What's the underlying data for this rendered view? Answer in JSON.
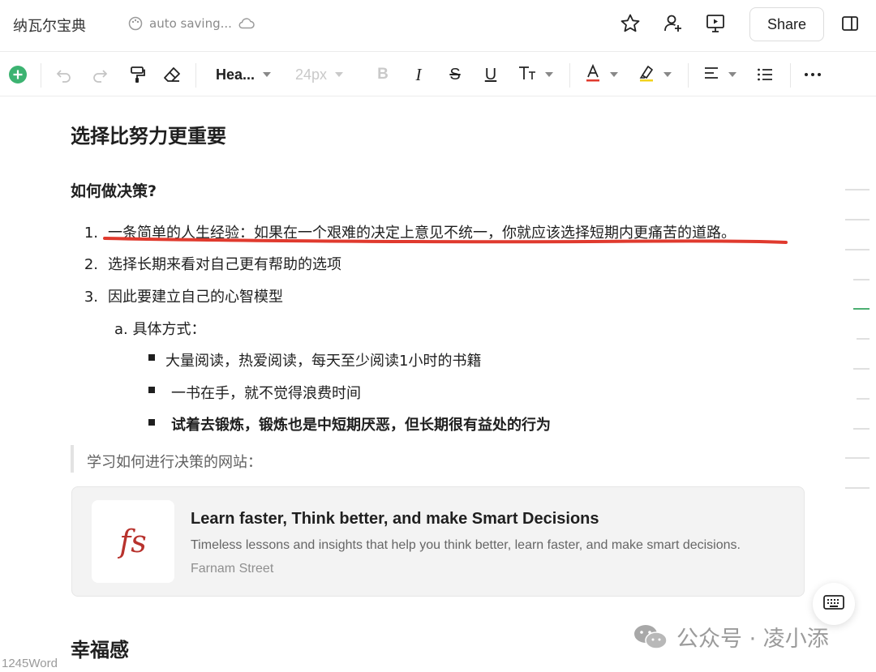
{
  "header": {
    "doc_title": "纳瓦尔宝典",
    "saving_status": "auto saving...",
    "share_label": "Share",
    "icons": [
      "palette-icon",
      "cloud-icon",
      "star-icon",
      "add-user-icon",
      "presentation-icon",
      "sidebar-toggle-icon"
    ]
  },
  "toolbar": {
    "heading_select": "Hea...",
    "font_size": "24px",
    "bold": "B",
    "italic": "I",
    "strike": "S",
    "underline": "U",
    "icons": [
      "add-icon",
      "undo-icon",
      "redo-icon",
      "format-painter-icon",
      "eraser-icon",
      "text-size-icon",
      "font-color-icon",
      "highlight-icon",
      "align-icon",
      "list-icon",
      "more-icon"
    ]
  },
  "document": {
    "title": "选择比努力更重要",
    "section_heading": "如何做决策?",
    "list": [
      {
        "num": "1.",
        "text": "一条简单的人生经验：如果在一个艰难的决定上意见不统一，你就应该选择短期内更痛苦的道路。"
      },
      {
        "num": "2.",
        "text": "选择长期来看对自己更有帮助的选项"
      },
      {
        "num": "3.",
        "text": "因此要建立自己的心智模型"
      }
    ],
    "sub_item": {
      "num": "a.",
      "text": "具体方式："
    },
    "bullets": [
      {
        "text": "大量阅读，热爱阅读，每天至少阅读1小时的书籍"
      },
      {
        "text": "一书在手，就不觉得浪费时间"
      },
      {
        "text": "试着去锻炼，锻炼也是中短期厌恶，但长期很有益处的行为"
      }
    ],
    "quote": "学习如何进行决策的网站：",
    "link_card": {
      "logo_text": "fs",
      "title": "Learn faster, Think better, and make Smart Decisions",
      "description": "Timeless lessons and insights that help you think better, learn faster, and make smart decisions.",
      "source": "Farnam Street"
    },
    "next_heading": "幸福感"
  },
  "footer": {
    "word_count": "1245Word",
    "watermark": "公众号 · 凌小添"
  },
  "colors": {
    "accent_green": "#3cb371",
    "underline_red": "#e03a2e",
    "card_logo_red": "#b8322d"
  }
}
